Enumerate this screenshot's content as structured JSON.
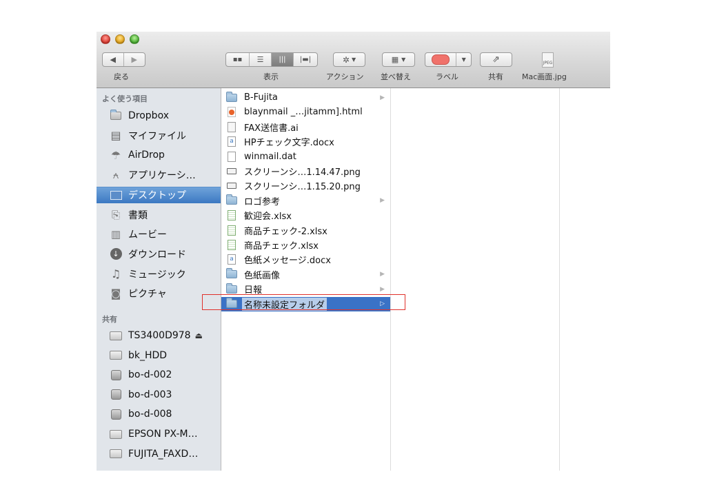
{
  "toolbar": {
    "back_label": "戻る",
    "view_label": "表示",
    "action_label": "アクション",
    "arrange_label": "並べ替え",
    "label_label": "ラベル",
    "share_label": "共有",
    "file_label": "Mac画面.jpg",
    "label_color": "#f0726b"
  },
  "sidebar": {
    "favorites_heading": "よく使う項目",
    "favorites": [
      {
        "label": "Dropbox",
        "icon": "folder-icon"
      },
      {
        "label": "マイファイル",
        "icon": "all-my-files-icon"
      },
      {
        "label": "AirDrop",
        "icon": "airdrop-icon"
      },
      {
        "label": "アプリケーシ…",
        "icon": "applications-icon"
      },
      {
        "label": "デスクトップ",
        "icon": "desktop-icon",
        "selected": true
      },
      {
        "label": "書類",
        "icon": "documents-icon"
      },
      {
        "label": "ムービー",
        "icon": "movies-icon"
      },
      {
        "label": "ダウンロード",
        "icon": "downloads-icon"
      },
      {
        "label": "ミュージック",
        "icon": "music-icon"
      },
      {
        "label": "ピクチャ",
        "icon": "pictures-icon"
      }
    ],
    "shared_heading": "共有",
    "shared": [
      {
        "label": "TS3400D978",
        "icon": "network-drive-icon",
        "eject": true
      },
      {
        "label": "bk_HDD",
        "icon": "network-drive-icon"
      },
      {
        "label": "bo-d-002",
        "icon": "pc-icon"
      },
      {
        "label": "bo-d-003",
        "icon": "pc-icon"
      },
      {
        "label": "bo-d-008",
        "icon": "pc-icon"
      },
      {
        "label": "EPSON PX-M…",
        "icon": "network-drive-icon"
      },
      {
        "label": "FUJITA_FAXD…",
        "icon": "network-drive-icon"
      }
    ]
  },
  "files": [
    {
      "name": "B-Fujita",
      "type": "folder-alias",
      "has_children": true
    },
    {
      "name": "blaynmail _…jitamm].html",
      "type": "html"
    },
    {
      "name": "FAX送信書.ai",
      "type": "ai"
    },
    {
      "name": "HPチェック文字.docx",
      "type": "docx"
    },
    {
      "name": "winmail.dat",
      "type": "dat"
    },
    {
      "name": "スクリーンシ…1.14.47.png",
      "type": "png"
    },
    {
      "name": "スクリーンシ…1.15.20.png",
      "type": "png"
    },
    {
      "name": "ロゴ参考",
      "type": "folder",
      "has_children": true
    },
    {
      "name": "歓迎会.xlsx",
      "type": "xlsx"
    },
    {
      "name": "商品チェック-2.xlsx",
      "type": "xlsx"
    },
    {
      "name": "商品チェック.xlsx",
      "type": "xlsx"
    },
    {
      "name": "色紙メッセージ.docx",
      "type": "docx"
    },
    {
      "name": "色紙画像",
      "type": "folder",
      "has_children": true
    },
    {
      "name": "日報",
      "type": "folder",
      "has_children": true
    },
    {
      "name": "名称未設定フォルダ",
      "type": "folder",
      "has_children": true,
      "selected": true,
      "editing": true
    }
  ]
}
